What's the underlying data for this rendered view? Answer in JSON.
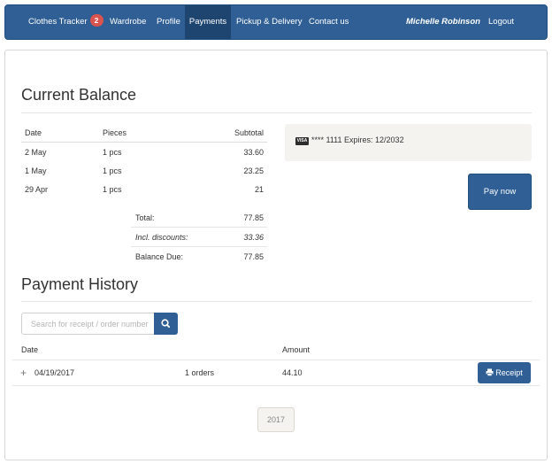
{
  "nav": {
    "items": [
      {
        "label": "Clothes Tracker",
        "badge": "2"
      },
      {
        "label": "Wardrobe"
      },
      {
        "label": "Profile"
      },
      {
        "label": "Payments"
      },
      {
        "label": "Pickup & Delivery"
      },
      {
        "label": "Contact us"
      }
    ],
    "user": "Michelle Robinson",
    "logout": "Logout"
  },
  "balance": {
    "title": "Current Balance",
    "columns": {
      "date": "Date",
      "pieces": "Pieces",
      "subtotal": "Subtotal"
    },
    "rows": [
      {
        "date": "2 May",
        "pieces": "1 pcs",
        "subtotal": "33.60"
      },
      {
        "date": "1 May",
        "pieces": "1 pcs",
        "subtotal": "23.25"
      },
      {
        "date": "29 Apr",
        "pieces": "1 pcs",
        "subtotal": "21"
      }
    ],
    "total_label": "Total:",
    "total_value": "77.85",
    "discount_label": "Incl. discounts:",
    "discount_value": "33.36",
    "due_label": "Balance Due:",
    "due_value": "77.85"
  },
  "card": {
    "brand": "VISA",
    "text": "**** 1111 Expires: 12/2032"
  },
  "pay_button": "Pay now",
  "history": {
    "title": "Payment History",
    "search_placeholder": "Search for receipt / order number",
    "columns": {
      "date": "Date",
      "amount": "Amount"
    },
    "rows": [
      {
        "expand": "+",
        "date": "04/19/2017",
        "orders": "1 orders",
        "amount": "44.10",
        "receipt": "Receipt"
      }
    ]
  },
  "pagination": {
    "year": "2017"
  },
  "colors": {
    "primary": "#2f5f94",
    "badge": "#d9534f",
    "panel": "#f5f3ef"
  },
  "icons": {
    "search": "search-icon",
    "print": "print-icon",
    "card": "visa-icon",
    "expand": "plus-icon"
  }
}
